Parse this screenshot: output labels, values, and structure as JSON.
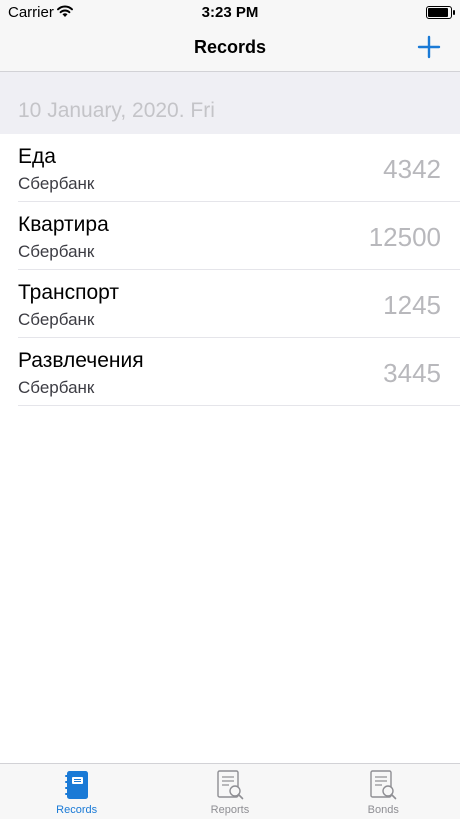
{
  "status_bar": {
    "carrier": "Carrier",
    "time": "3:23 PM",
    "battery_level": 1.0
  },
  "nav": {
    "title": "Records",
    "add_icon": "plus-icon"
  },
  "section": {
    "title": "10 January, 2020. Fri"
  },
  "records": [
    {
      "title": "Еда",
      "subtitle": "Сбербанк",
      "amount": "4342"
    },
    {
      "title": "Квартира",
      "subtitle": "Сбербанк",
      "amount": "12500"
    },
    {
      "title": "Транспорт",
      "subtitle": "Сбербанк",
      "amount": "1245"
    },
    {
      "title": "Развлечения",
      "subtitle": "Сбербанк",
      "amount": "3445"
    }
  ],
  "tabs": [
    {
      "label": "Records",
      "icon": "notebook-icon",
      "active": true
    },
    {
      "label": "Reports",
      "icon": "document-search-icon",
      "active": false
    },
    {
      "label": "Bonds",
      "icon": "document-search-icon",
      "active": false
    }
  ],
  "colors": {
    "accent": "#1a7ad6",
    "inactive": "#8e8e93",
    "amount": "#b8b8bc"
  }
}
